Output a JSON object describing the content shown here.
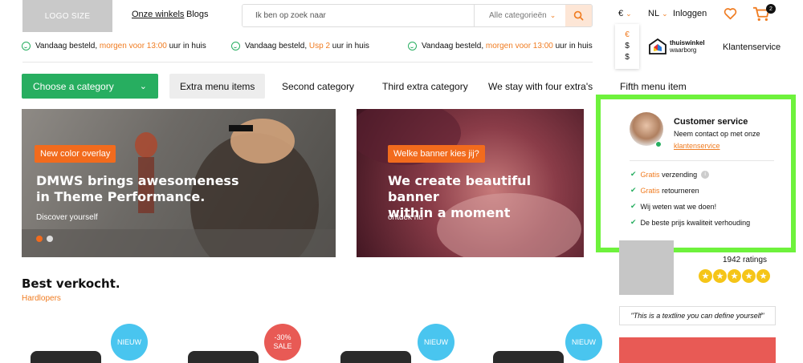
{
  "header": {
    "logo": "LOGO SIZE",
    "nav": [
      "Onze winkels",
      "Blogs"
    ],
    "search_placeholder": "Ik ben op zoek naar",
    "category_select": "Alle categorieën",
    "currency": "€",
    "currency_options": [
      "€",
      "$",
      "$"
    ],
    "language": "NL",
    "login": "Inloggen",
    "cart_count": "2"
  },
  "usps": [
    {
      "pre": "Vandaag besteld,",
      "hl": "morgen voor 13:00",
      "post": "uur in huis"
    },
    {
      "pre": "Vandaag besteld,",
      "hl": "Usp 2",
      "post": "uur in huis"
    },
    {
      "pre": "Vandaag besteld,",
      "hl": "morgen voor 13:00",
      "post": "uur in huis"
    }
  ],
  "thuiswinkel": {
    "line1": "thuiswinkel",
    "line2": "waarborg"
  },
  "klantenservice": "Klantenservice",
  "menu": {
    "choose": "Choose a category",
    "items": [
      "Extra menu items",
      "Second category",
      "Third extra category",
      "We stay with four extra's",
      "Fifth menu item"
    ]
  },
  "banners": [
    {
      "tag": "New color overlay",
      "title_l1": "DMWS brings awesomeness",
      "title_l2": "in Theme Performance.",
      "sub": "Discover yourself"
    },
    {
      "tag": "Welke banner kies jij?",
      "title_l1": "We create beautiful banner",
      "title_l2": "within a moment",
      "sub": "ontdek nu"
    }
  ],
  "customer_service": {
    "title": "Customer service",
    "line1": "Neem contact op met onze",
    "link": "klantenservice",
    "items": [
      {
        "hl": "Gratis",
        "text": " verzending"
      },
      {
        "hl": "Gratis",
        "text": " retourneren"
      },
      {
        "hl": "",
        "text": "Wij weten wat we doen!"
      },
      {
        "hl": "",
        "text": "De beste prijs kwaliteit verhouding"
      }
    ]
  },
  "ratings": "1942 ratings",
  "rating_stars": 5,
  "quote": "\"This is a textline you can define yourself\"",
  "bestsellers": {
    "title": "Best verkocht.",
    "subtitle": "Hardlopers",
    "badges": [
      {
        "type": "new",
        "l1": "NIEUW",
        "l2": ""
      },
      {
        "type": "sale",
        "l1": "-30%",
        "l2": "SALE"
      },
      {
        "type": "new",
        "l1": "NIEUW",
        "l2": ""
      },
      {
        "type": "new",
        "l1": "NIEUW",
        "l2": ""
      }
    ]
  },
  "colors": {
    "accent": "#f07c21",
    "green": "#27ae60",
    "highlight_border": "#6ef23c"
  }
}
